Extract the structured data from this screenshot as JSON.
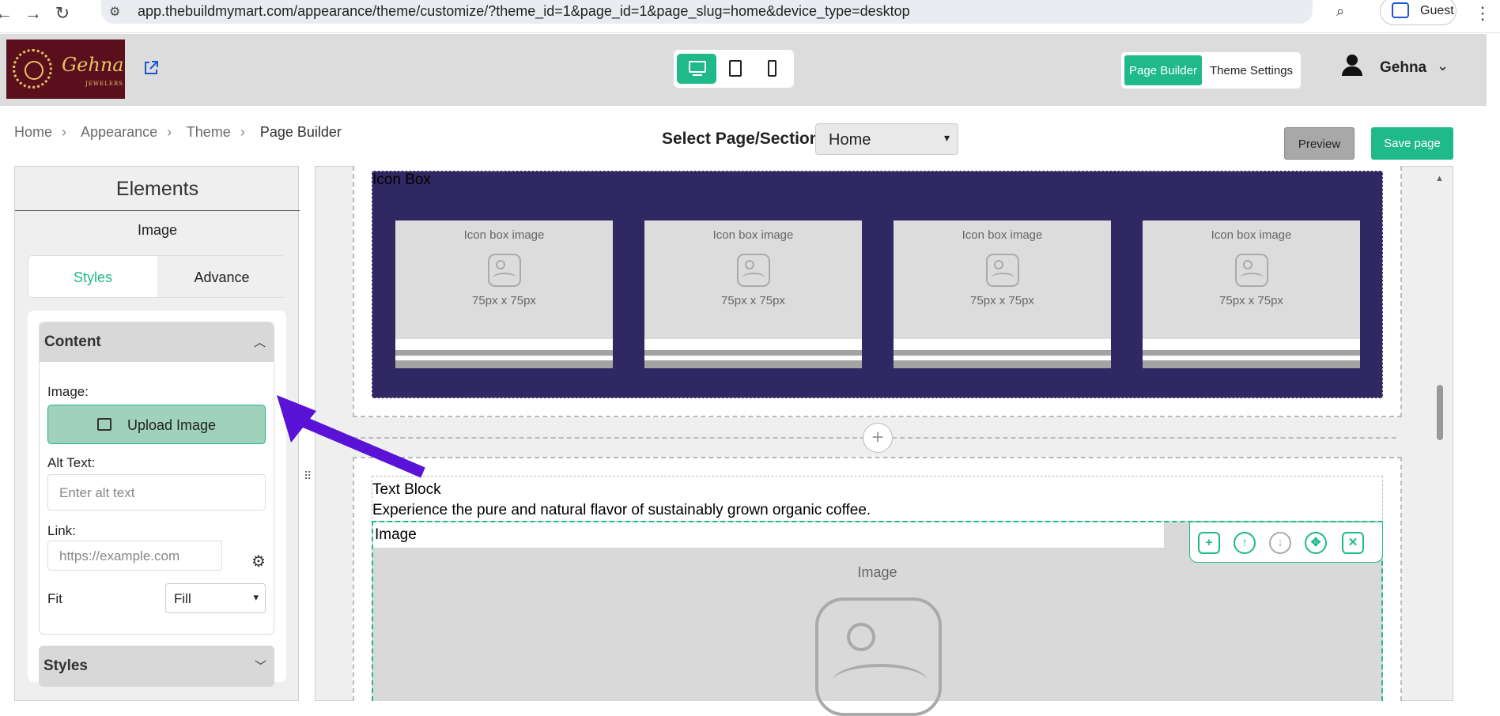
{
  "browser": {
    "url": "app.thebuildmymart.com/appearance/theme/customize/?theme_id=1&page_id=1&page_slug=home&device_type=desktop",
    "guest_label": "Guest"
  },
  "header": {
    "logo_name": "Gehna",
    "logo_sub": "JEWELERS",
    "page_builder_label": "Page Builder",
    "theme_settings_label": "Theme Settings",
    "user_name": "Gehna"
  },
  "breadcrumb": [
    "Home",
    "Appearance",
    "Theme",
    "Page Builder"
  ],
  "toolbar": {
    "select_label": "Select Page/Section:",
    "selected_page": "Home",
    "preview_label": "Preview",
    "save_label": "Save page"
  },
  "panel": {
    "title": "Elements",
    "subtitle": "Image",
    "tab_styles": "Styles",
    "tab_advance": "Advance",
    "content_header": "Content",
    "image_label": "Image:",
    "upload_label": "Upload Image",
    "alt_label": "Alt Text:",
    "alt_placeholder": "Enter alt text",
    "link_label": "Link:",
    "link_placeholder": "https://example.com",
    "fit_label": "Fit",
    "fit_value": "Fill",
    "styles_header": "Styles"
  },
  "canvas": {
    "icon_box_label": "Icon Box",
    "icon_box_cards": [
      {
        "caption": "Icon box image",
        "size": "75px x 75px"
      },
      {
        "caption": "Icon box image",
        "size": "75px x 75px"
      },
      {
        "caption": "Icon box image",
        "size": "75px x 75px"
      },
      {
        "caption": "Icon box image",
        "size": "75px x 75px"
      }
    ],
    "text_block_label": "Text Block",
    "text_block_body": "Experience the pure and natural flavor of sustainably grown organic coffee.",
    "image_label": "Image",
    "image_caption": "Image"
  },
  "colors": {
    "accent": "#1fb98a",
    "icon_box_bg": "#2f2862",
    "arrow": "#5a12d6"
  }
}
